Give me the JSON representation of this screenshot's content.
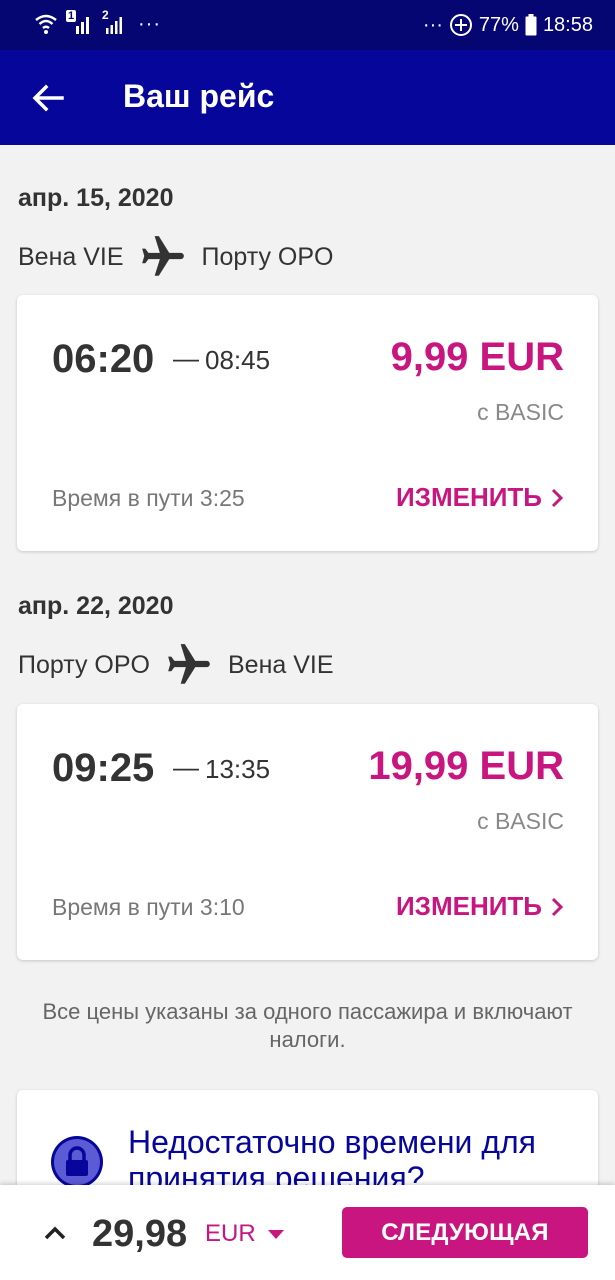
{
  "status": {
    "sim1": "1",
    "sim2": "2",
    "more_left": "···",
    "more_right": "···",
    "battery": "77%",
    "time": "18:58"
  },
  "appbar": {
    "title": "Ваш рейс"
  },
  "flights": [
    {
      "date": "апр. 15, 2020",
      "from": "Вена VIE",
      "to": "Порту OPO",
      "dep": "06:20",
      "dash": "—",
      "arr": "08:45",
      "price": "9,99 EUR",
      "fare": "с BASIC",
      "duration": "Время в пути 3:25",
      "change": "ИЗМЕНИТЬ"
    },
    {
      "date": "апр. 22, 2020",
      "from": "Порту OPO",
      "to": "Вена VIE",
      "dep": "09:25",
      "dash": "—",
      "arr": "13:35",
      "price": "19,99 EUR",
      "fare": "с BASIC",
      "duration": "Время в пути 3:10",
      "change": "ИЗМЕНИТЬ"
    }
  ],
  "note": "Все цены указаны за одного пассажира и включают налоги.",
  "promo": {
    "title": "Недостаточно времени для принятия решения?"
  },
  "bottom": {
    "total": "29,98",
    "currency": "EUR",
    "next": "СЛЕДУЮЩАЯ"
  },
  "colors": {
    "header": "#06069b",
    "statusbar": "#060672",
    "accent": "#c8157f"
  },
  "icons": [
    "wifi-icon",
    "signal-icon",
    "add-circle-icon",
    "battery-icon",
    "back-arrow-icon",
    "airplane-icon",
    "chevron-right-icon",
    "lock-icon",
    "chevron-up-icon",
    "dropdown-triangle-icon"
  ]
}
